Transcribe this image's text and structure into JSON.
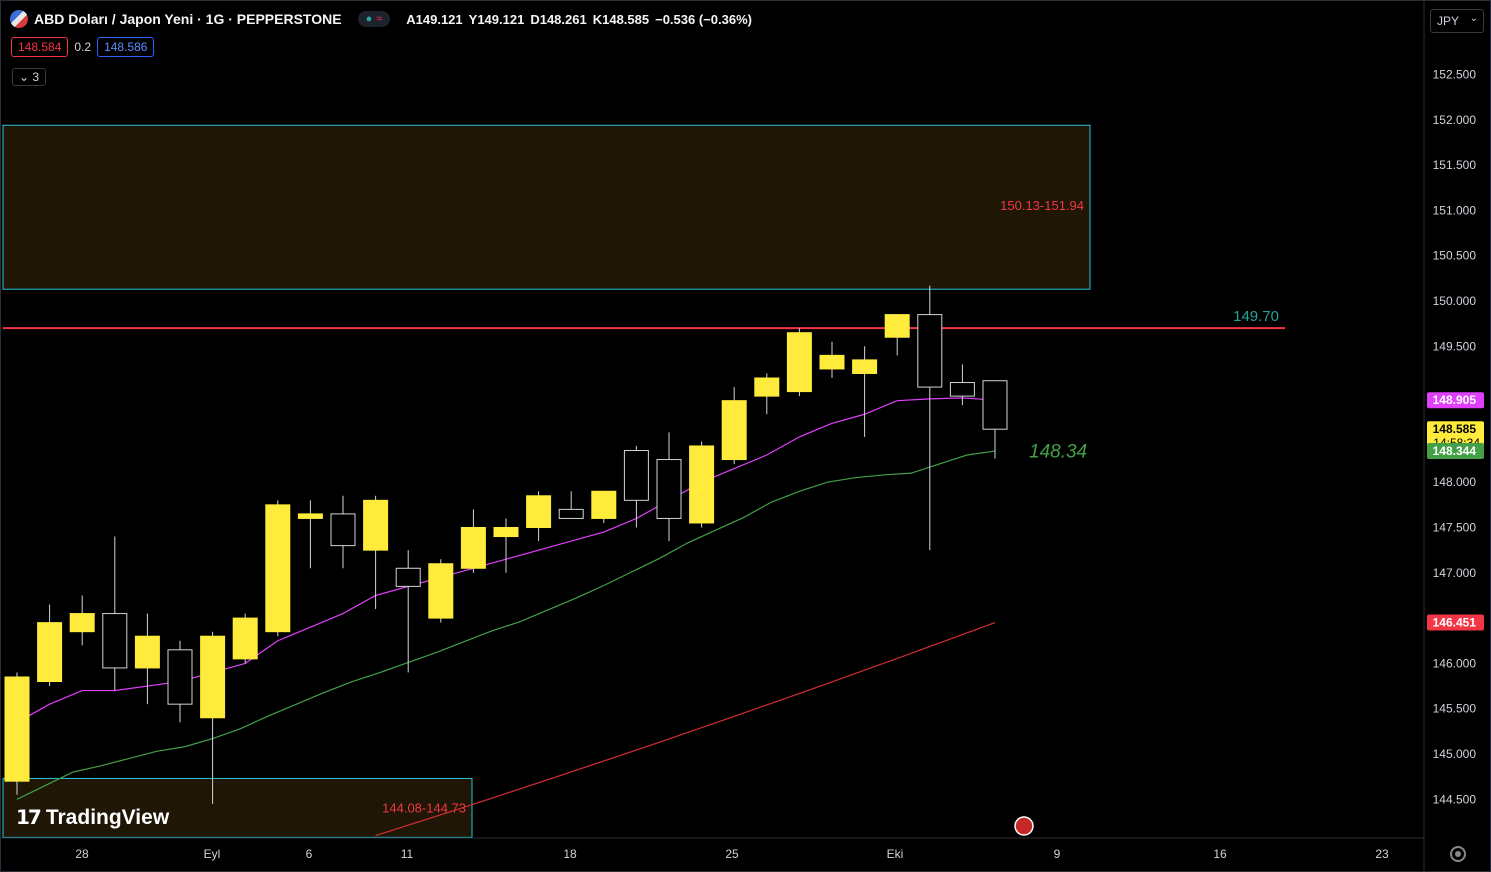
{
  "header": {
    "symbol": "ABD Doları / Japon Yeni · 1G · PEPPERSTONE",
    "open": "A149.121",
    "high": "Y149.121",
    "low": "D148.261",
    "close": "K148.585",
    "change": "−0.536 (−0.36%)"
  },
  "quote": {
    "bid": "148.584",
    "spread": "0.2",
    "ask": "148.586"
  },
  "indicators": {
    "collapsed_count": "3"
  },
  "currency": {
    "label": "JPY"
  },
  "branding": {
    "name": "TradingView"
  },
  "chart_data": {
    "type": "candlestick",
    "title": "ABD Doları / Japon Yeni · 1G · PEPPERSTONE",
    "yaxis": {
      "min": 144.08,
      "max": 152.92,
      "ticks": [
        "144.500",
        "145.000",
        "145.500",
        "146.000",
        "147.000",
        "147.500",
        "148.000",
        "149.500",
        "150.000",
        "150.500",
        "151.000",
        "151.500",
        "152.000",
        "152.500"
      ]
    },
    "xaxis_labels": [
      "28",
      "Eyl",
      "6",
      "11",
      "18",
      "25",
      "Eki",
      "9",
      "16",
      "23"
    ],
    "candles": [
      {
        "o": 144.7,
        "h": 145.9,
        "l": 144.55,
        "c": 145.85
      },
      {
        "o": 145.8,
        "h": 146.65,
        "l": 145.75,
        "c": 146.45
      },
      {
        "o": 146.35,
        "h": 146.75,
        "l": 146.2,
        "c": 146.55
      },
      {
        "o": 146.55,
        "h": 147.4,
        "l": 145.7,
        "c": 145.95
      },
      {
        "o": 145.95,
        "h": 146.55,
        "l": 145.55,
        "c": 146.3
      },
      {
        "o": 146.15,
        "h": 146.25,
        "l": 145.35,
        "c": 145.55
      },
      {
        "o": 145.4,
        "h": 146.35,
        "l": 144.45,
        "c": 146.3
      },
      {
        "o": 146.05,
        "h": 146.55,
        "l": 146.0,
        "c": 146.5
      },
      {
        "o": 146.35,
        "h": 147.8,
        "l": 146.3,
        "c": 147.75
      },
      {
        "o": 147.6,
        "h": 147.8,
        "l": 147.05,
        "c": 147.65
      },
      {
        "o": 147.65,
        "h": 147.85,
        "l": 147.05,
        "c": 147.3
      },
      {
        "o": 147.25,
        "h": 147.85,
        "l": 146.6,
        "c": 147.8
      },
      {
        "o": 147.05,
        "h": 147.25,
        "l": 145.9,
        "c": 146.85
      },
      {
        "o": 146.5,
        "h": 147.15,
        "l": 146.45,
        "c": 147.1
      },
      {
        "o": 147.05,
        "h": 147.7,
        "l": 147.0,
        "c": 147.5
      },
      {
        "o": 147.4,
        "h": 147.6,
        "l": 147.0,
        "c": 147.5
      },
      {
        "o": 147.5,
        "h": 147.9,
        "l": 147.35,
        "c": 147.85
      },
      {
        "o": 147.7,
        "h": 147.9,
        "l": 147.6,
        "c": 147.6
      },
      {
        "o": 147.6,
        "h": 147.9,
        "l": 147.55,
        "c": 147.9
      },
      {
        "o": 148.35,
        "h": 148.4,
        "l": 147.5,
        "c": 147.8
      },
      {
        "o": 148.25,
        "h": 148.55,
        "l": 147.35,
        "c": 147.6
      },
      {
        "o": 147.55,
        "h": 148.45,
        "l": 147.5,
        "c": 148.4
      },
      {
        "o": 148.25,
        "h": 149.05,
        "l": 148.2,
        "c": 148.9
      },
      {
        "o": 148.95,
        "h": 149.2,
        "l": 148.75,
        "c": 149.15
      },
      {
        "o": 149.0,
        "h": 149.7,
        "l": 148.95,
        "c": 149.65
      },
      {
        "o": 149.25,
        "h": 149.55,
        "l": 149.15,
        "c": 149.4
      },
      {
        "o": 149.2,
        "h": 149.5,
        "l": 148.5,
        "c": 149.35
      },
      {
        "o": 149.6,
        "h": 149.85,
        "l": 149.4,
        "c": 149.85
      },
      {
        "o": 149.85,
        "h": 150.17,
        "l": 147.25,
        "c": 149.05
      },
      {
        "o": 149.1,
        "h": 149.3,
        "l": 148.85,
        "c": 148.95
      },
      {
        "o": 149.12,
        "h": 149.12,
        "l": 148.26,
        "c": 148.585
      }
    ],
    "ma_short": [
      145.35,
      145.55,
      145.7,
      145.7,
      145.75,
      145.8,
      145.9,
      146.0,
      146.25,
      146.4,
      146.55,
      146.75,
      146.85,
      146.95,
      147.05,
      147.15,
      147.25,
      147.35,
      147.45,
      147.6,
      147.8,
      148.0,
      148.15,
      148.3,
      148.5,
      148.65,
      148.75,
      148.9,
      148.92,
      148.93,
      148.905
    ],
    "ma_mid": [
      144.5,
      144.65,
      144.8,
      144.87,
      144.95,
      145.03,
      145.08,
      145.17,
      145.28,
      145.42,
      145.55,
      145.68,
      145.8,
      145.9,
      146.01,
      146.12,
      146.24,
      146.36,
      146.46,
      146.59,
      146.72,
      146.86,
      147.01,
      147.16,
      147.33,
      147.47,
      147.61,
      147.78,
      147.9,
      148.0,
      148.05,
      148.08,
      148.1,
      148.2,
      148.3,
      148.344
    ],
    "ma_long_start": {
      "index": 11,
      "value": 144.1
    },
    "ma_long_end": {
      "index": 30,
      "value": 146.451
    },
    "resistance": {
      "value": 149.7,
      "label": "149.70"
    },
    "zones": [
      {
        "low": 150.13,
        "high": 151.94,
        "label": "150.13-151.94"
      },
      {
        "low": 144.08,
        "high": 144.73,
        "label": "144.08-144.73"
      }
    ],
    "annotation": "148.34",
    "price_labels": [
      {
        "value": 148.905,
        "text": "148.905",
        "color": "#e040fb"
      },
      {
        "value": 148.585,
        "text": "148.585",
        "sub": "14:58:34",
        "color": "#ffeb3b"
      },
      {
        "value": 148.344,
        "text": "148.344",
        "color": "#43a047"
      },
      {
        "value": 146.451,
        "text": "146.451",
        "color": "#f23645"
      }
    ],
    "colors": {
      "up": "#ffeb3b",
      "down": "#000000",
      "wick": "#d1d4dc",
      "ma_short": "#e040fb",
      "ma_mid": "#43a047",
      "ma_long": "#d32f2f",
      "resistance": "#f23645",
      "zone_border": "#26c6da"
    }
  }
}
